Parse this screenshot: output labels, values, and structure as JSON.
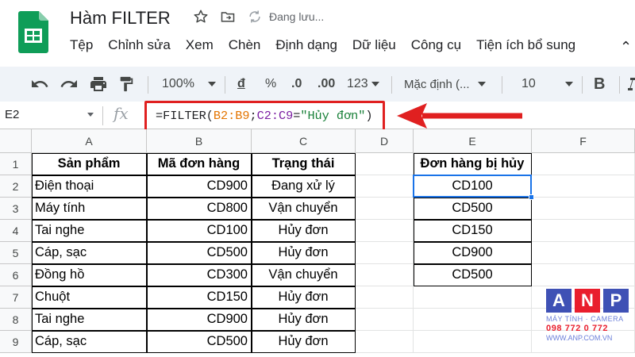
{
  "app": {
    "doc_title": "Hàm FILTER",
    "saving_status": "Đang lưu...",
    "menu": [
      "Tệp",
      "Chỉnh sửa",
      "Xem",
      "Chèn",
      "Định dạng",
      "Dữ liệu",
      "Công cụ",
      "Tiện ích bổ sung"
    ]
  },
  "toolbar": {
    "zoom": "100%",
    "currency": "đ",
    "percent": "%",
    "dec_decrease": ".0",
    "dec_increase": ".00",
    "more_formats": "123",
    "font": "Mặc định (...",
    "font_size": "10",
    "bold": "B"
  },
  "formula_bar": {
    "name_box": "E2",
    "fx": "fx",
    "formula_parts": [
      "=FILTER(",
      "B2:B9",
      ";",
      "C2:C9",
      "=",
      "\"Hủy đơn\"",
      ")"
    ]
  },
  "grid": {
    "columns": [
      "A",
      "B",
      "C",
      "D",
      "E",
      "F"
    ],
    "rows": [
      "1",
      "2",
      "3",
      "4",
      "5",
      "6",
      "7",
      "8",
      "9"
    ],
    "headers": {
      "A": "Sản phẩm",
      "B": "Mã đơn hàng",
      "C": "Trạng thái",
      "E": "Đơn hàng bị hủy"
    },
    "data": [
      {
        "A": "Điện thoại",
        "B": "CD900",
        "C": "Đang xử lý",
        "E": "CD100"
      },
      {
        "A": "Máy tính",
        "B": "CD800",
        "C": "Vận chuyển",
        "E": "CD500"
      },
      {
        "A": "Tai nghe",
        "B": "CD100",
        "C": "Hủy đơn",
        "E": "CD150"
      },
      {
        "A": "Cáp, sạc",
        "B": "CD500",
        "C": "Hủy đơn",
        "E": "CD900"
      },
      {
        "A": "Đồng hồ",
        "B": "CD300",
        "C": "Vận chuyển",
        "E": "CD500"
      },
      {
        "A": "Chuột",
        "B": "CD150",
        "C": "Hủy đơn",
        "E": ""
      },
      {
        "A": "Tai nghe",
        "B": "CD900",
        "C": "Hủy đơn",
        "E": ""
      },
      {
        "A": "Cáp, sạc",
        "B": "CD500",
        "C": "Hủy đơn",
        "E": ""
      }
    ],
    "selected_cell": "E2"
  },
  "watermark": {
    "letters": [
      "A",
      "N",
      "P"
    ],
    "tagline": "MÁY TÍNH · CAMERA",
    "phone": "098 772 0 772",
    "website": "WWW.ANP.COM.VN"
  },
  "colors": {
    "accent": "#1a73e8",
    "arrow_red": "#e02020",
    "sheets_green": "#0f9d58",
    "anp_blue": "#3f51b5",
    "anp_red": "#e91e2d"
  }
}
